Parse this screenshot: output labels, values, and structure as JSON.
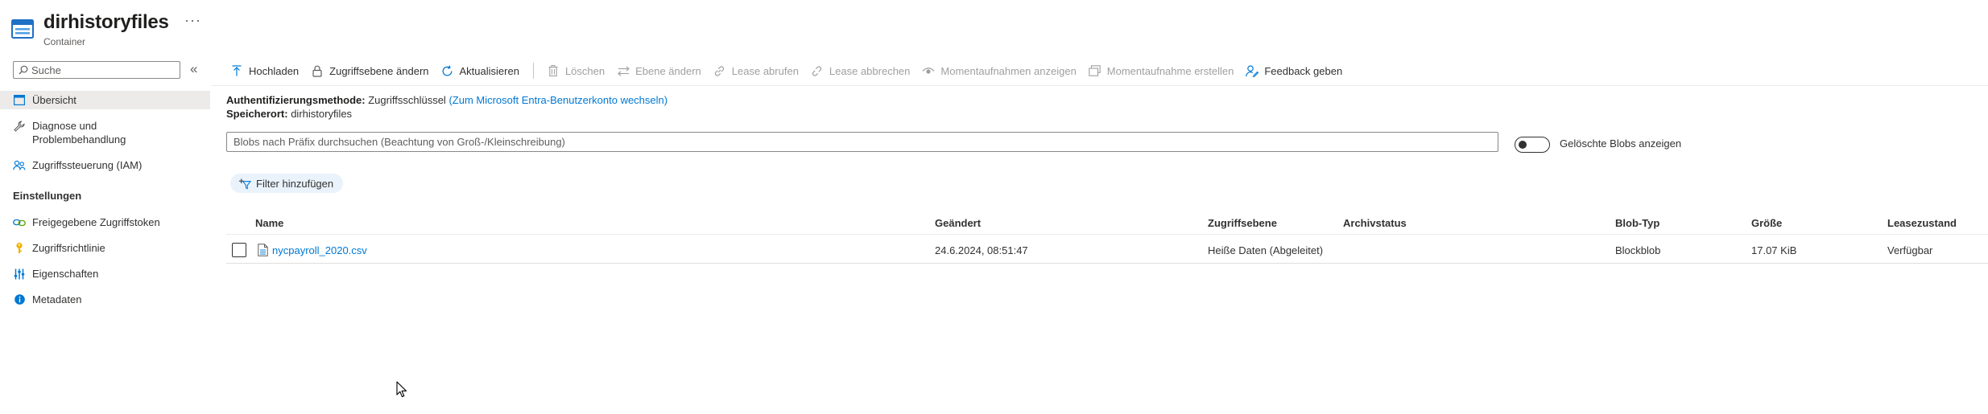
{
  "header": {
    "title": "dirhistoryfiles",
    "subtitle": "Container",
    "more_label": "···",
    "icon": "storage-container-icon"
  },
  "sidebar": {
    "search_placeholder": "Suche",
    "collapse_label": "«",
    "items": [
      {
        "label": "Übersicht",
        "icon": "overview-icon",
        "active": true
      },
      {
        "label": "Diagnose und Problembehandlung",
        "icon": "wrench-icon"
      },
      {
        "label": "Zugriffssteuerung (IAM)",
        "icon": "people-icon"
      }
    ],
    "section_settings": "Einstellungen",
    "settings_items": [
      {
        "label": "Freigegebene Zugriffstoken",
        "icon": "link-icon"
      },
      {
        "label": "Zugriffsrichtlinie",
        "icon": "key-icon"
      },
      {
        "label": "Eigenschaften",
        "icon": "properties-icon"
      },
      {
        "label": "Metadaten",
        "icon": "info-icon"
      }
    ]
  },
  "toolbar": {
    "upload": "Hochladen",
    "change_access_level": "Zugriffsebene ändern",
    "refresh": "Aktualisieren",
    "delete": "Löschen",
    "change_tier": "Ebene ändern",
    "acquire_lease": "Lease abrufen",
    "break_lease": "Lease abbrechen",
    "show_snapshots": "Momentaufnahmen anzeigen",
    "create_snapshot": "Momentaufnahme erstellen",
    "feedback": "Feedback geben"
  },
  "info": {
    "auth_label": "Authentifizierungsmethode:",
    "auth_value": "Zugriffsschlüssel",
    "auth_link": "(Zum Microsoft Entra-Benutzerkonto wechseln)",
    "location_label": "Speicherort:",
    "location_value": "dirhistoryfiles"
  },
  "filter": {
    "prefix_placeholder": "Blobs nach Präfix durchsuchen (Beachtung von Groß-/Kleinschreibung)",
    "show_deleted_label": "Gelöschte Blobs anzeigen",
    "show_deleted_on": false,
    "add_filter_label": "Filter hinzufügen"
  },
  "table": {
    "columns": [
      "Name",
      "Geändert",
      "Zugriffsebene",
      "Archivstatus",
      "Blob-Typ",
      "Größe",
      "Leasezustand"
    ],
    "rows": [
      {
        "name": "nycpayroll_2020.csv",
        "modified": "24.6.2024, 08:51:47",
        "access_tier": "Heiße Daten (Abgeleitet)",
        "archive_status": "",
        "blob_type": "Blockblob",
        "size": "17.07 KiB",
        "lease_state": "Verfügbar"
      }
    ]
  },
  "colors": {
    "accent": "#0078d4",
    "selected_nav_bg": "#edebe9",
    "filter_pill_bg": "#eaf3fc"
  }
}
